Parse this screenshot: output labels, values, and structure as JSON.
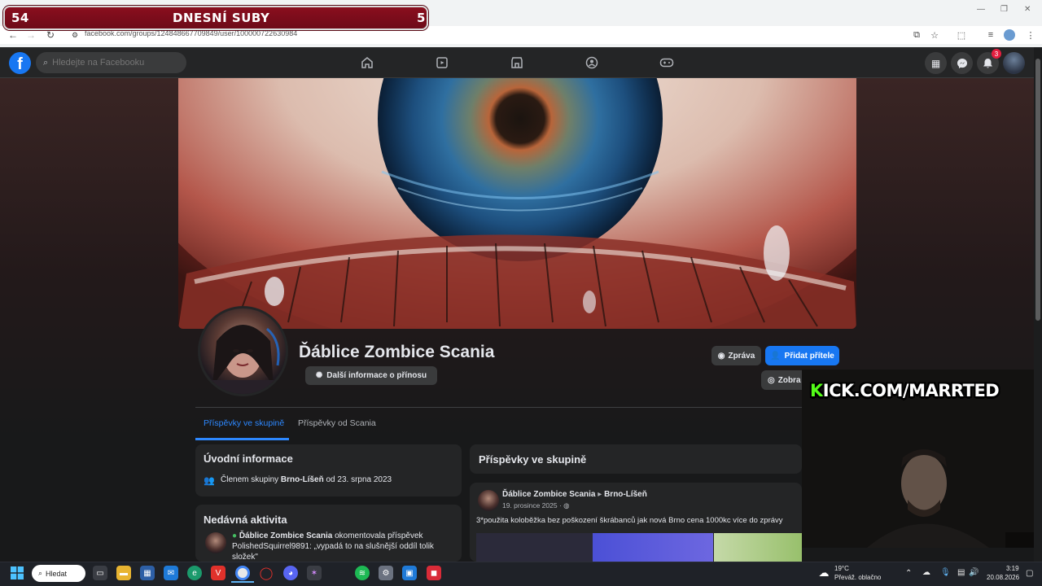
{
  "overlay": {
    "left_number": "54",
    "title": "DNESNÍ SUBY",
    "right_number": "5",
    "kick_k": "K",
    "kick_rest": "ICK.COM/MARRTED"
  },
  "browser": {
    "url": "facebook.com/groups/124848667709849/user/100000722630984"
  },
  "facebook": {
    "search_placeholder": "Hledejte na Facebooku",
    "notification_count": "3",
    "profile": {
      "name": "Ďáblice Zombice Scania",
      "contribution_button": "Další informace o přínosu",
      "message_button": "Zpráva",
      "add_friend_button": "Přidat přítele",
      "show_button": "Zobra"
    },
    "tabs": [
      "Příspěvky ve skupině",
      "Příspěvky od Scania"
    ],
    "intro": {
      "title": "Úvodní informace",
      "member_prefix": "Členem skupiny ",
      "group_name": "Brno-Líšeň",
      "member_suffix": " od 23. srpna 2023"
    },
    "recent": {
      "title": "Nedávná aktivita",
      "actor": "Ďáblice Zombice Scania",
      "action": " okomentovala příspěvek",
      "line2": "PolishedSquirrel9891: „vypadá to na slušnější oddíl tolik",
      "line3": "složek\""
    },
    "posts": {
      "title": "Příspěvky ve skupině",
      "author": "Ďáblice Zombice Scania",
      "group": "Brno-Líšeň",
      "date": "19. prosince 2025 ·",
      "text": "3*použita koloběžka bez poškození škrábanců jak nová Brno cena 1000kc více do zprávy"
    }
  },
  "taskbar": {
    "search_label": "Hledat",
    "weather_temp": "19°C",
    "weather_desc": "Převáž. oblačno",
    "time": "3:19",
    "date": "20.08.2026"
  },
  "colors": {
    "fb_blue": "#1877f2",
    "fb_dark": "#242526",
    "banner_red": "#8a0e1e",
    "kick_green": "#53fc18"
  }
}
